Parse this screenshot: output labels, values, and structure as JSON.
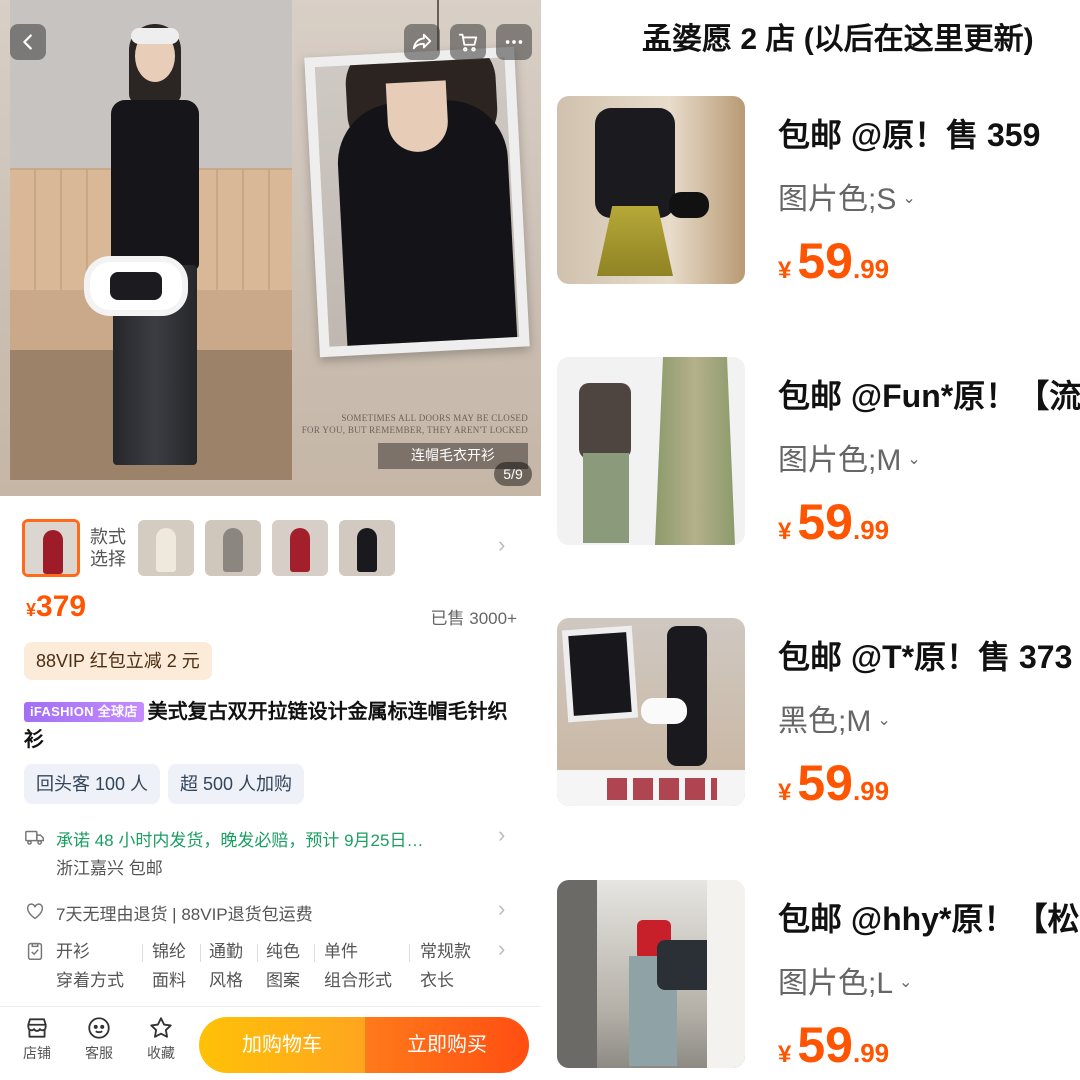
{
  "hero": {
    "caption_small_1": "SOMETIMES ALL DOORS MAY BE CLOSED",
    "caption_small_2": "FOR YOU, BUT REMEMBER, THEY AREN'T LOCKED",
    "caption_box": "连帽毛衣开衫",
    "page_indicator": "5/9",
    "icons": [
      "back-icon",
      "share-icon",
      "cart-icon",
      "more-icon"
    ]
  },
  "variants": {
    "label_line1": "款式",
    "label_line2": "选择",
    "thumbs": [
      "red-hoodie",
      "cream-cardigan",
      "grey-cardigan",
      "red-cardigan-jeans",
      "black-cardigan"
    ]
  },
  "product": {
    "currency": "¥",
    "price": "379",
    "sold": "已售 3000+",
    "vip_promo": "88VIP 红包立减 2 元",
    "brand_badge": "iFASHION 全球店",
    "title": "美式复古双开拉链设计金属标连帽毛针织衫",
    "tags": [
      "回头客 100 人",
      "超 500 人加购"
    ],
    "shipping_line": "承诺 48 小时内发货，晚发必赔，预计 9月25日…",
    "shipping_sub": "浙江嘉兴  包邮",
    "service": "7天无理由退货 | 88VIP退货包运费",
    "params_values": [
      "开衫",
      "锦纶",
      "通勤",
      "纯色",
      "单件",
      "常规款"
    ],
    "params_keys": [
      "穿着方式",
      "面料",
      "风格",
      "图案",
      "组合形式",
      "衣长"
    ]
  },
  "bottom_bar": {
    "shop": "店铺",
    "service": "客服",
    "favorite": "收藏",
    "add_cart": "加购物车",
    "buy_now": "立即购买"
  },
  "right": {
    "shop_title": "孟婆愿 2 店 (以后在这里更新)",
    "items": [
      {
        "title": "包邮 @原！售 359",
        "variant": "图片色;S",
        "yen": "¥",
        "price_int": "59",
        "price_dec": ".99"
      },
      {
        "title": "包邮 @Fun*原！【流",
        "variant": "图片色;M",
        "yen": "¥",
        "price_int": "59",
        "price_dec": ".99"
      },
      {
        "title": "包邮 @T*原！售 373",
        "variant": "黑色;M",
        "yen": "¥",
        "price_int": "59",
        "price_dec": ".99"
      },
      {
        "title": "包邮 @hhy*原！【松",
        "variant": "图片色;L",
        "yen": "¥",
        "price_int": "59",
        "price_dec": ".99"
      }
    ]
  },
  "colors": {
    "accent_orange": "#ff5500",
    "ship_green": "#1a9e62",
    "cart_yellow": "#ffb012",
    "vip_bg": "#fdebd9"
  }
}
